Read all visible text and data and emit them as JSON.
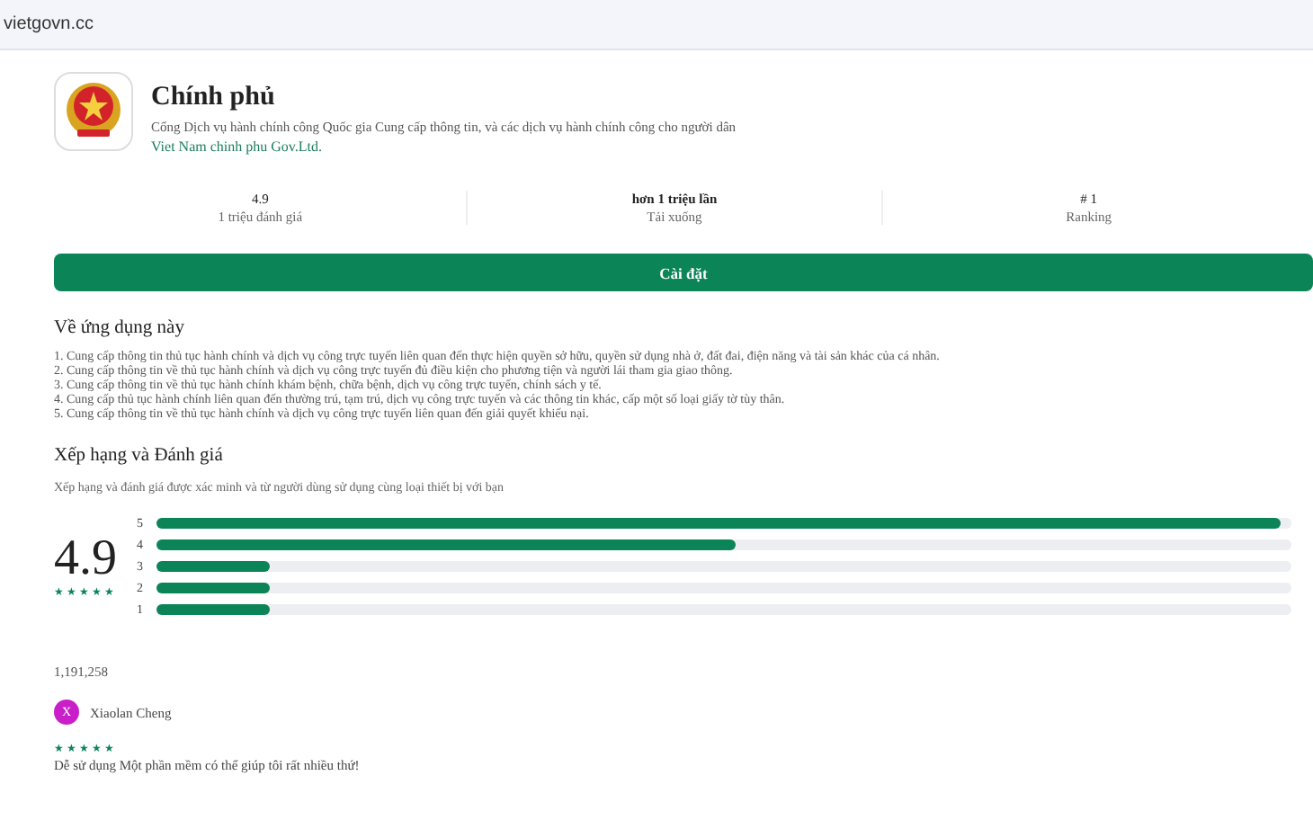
{
  "address_bar": {
    "url": "vietgovn.cc"
  },
  "app": {
    "name": "Chính phủ",
    "description": "Cổng Dịch vụ hành chính công Quốc gia Cung cấp thông tin, và các dịch vụ hành chính công cho người dân",
    "developer": "Viet Nam chinh phu Gov.Ltd."
  },
  "stats": [
    {
      "value": "4.9",
      "label": "1 triệu đánh giá"
    },
    {
      "value": "hơn 1 triệu lần",
      "label": "Tải xuống"
    },
    {
      "value": "# 1",
      "label": "Ranking"
    }
  ],
  "install_button": "Cài đặt",
  "about": {
    "heading": "Về ứng dụng này",
    "lines": [
      "1. Cung cấp thông tin thủ tục hành chính và dịch vụ công trực tuyến liên quan đến thực hiện quyền sở hữu, quyền sử dụng nhà ở, đất đai, điện năng và tài sản khác của cá nhân.",
      "2. Cung cấp thông tin về thủ tục hành chính và dịch vụ công trực tuyến đủ điều kiện cho phương tiện và người lái tham gia giao thông.",
      "3. Cung cấp thông tin về thủ tục hành chính khám bệnh, chữa bệnh, dịch vụ công trực tuyến, chính sách y tế.",
      "4. Cung cấp thủ tục hành chính liên quan đến thường trú, tạm trú, dịch vụ công trực tuyến và các thông tin khác, cấp một số loại giấy tờ tùy thân.",
      "5. Cung cấp thông tin về thủ tục hành chính và dịch vụ công trực tuyến liên quan đến giải quyết khiếu nại."
    ]
  },
  "ratings": {
    "heading": "Xếp hạng và Đánh giá",
    "subtitle": "Xếp hạng và đánh giá được xác minh và từ người dùng sử dụng cùng loại thiết bị với bạn",
    "score": "4.9",
    "stars": 5,
    "bars": [
      {
        "label": "5",
        "level": 0.99
      },
      {
        "label": "4",
        "level": 0.51
      },
      {
        "label": "3",
        "level": 0.1
      },
      {
        "label": "2",
        "level": 0.1
      },
      {
        "label": "1",
        "level": 0.1
      }
    ],
    "count": "1,191,258"
  },
  "reviews": [
    {
      "initial": "X",
      "name": "Xiaolan Cheng",
      "color": "#c81fc8",
      "stars": 5,
      "text": "Dễ sử dụng Một phần mềm có thể giúp tôi rất nhiều thứ!"
    }
  ]
}
